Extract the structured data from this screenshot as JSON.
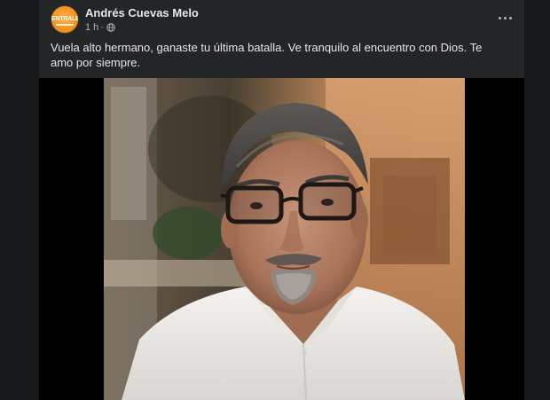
{
  "post": {
    "author": "Andrés Cuevas Melo",
    "avatar_label": "ENTRALE",
    "time": "1 h",
    "separator": "·",
    "privacy_icon": "globe-icon",
    "more_icon": "more-horizontal-icon",
    "text": "Vuela alto hermano, ganaste tu última batalla. Ve tranquilo al encuentro con Dios. Te amo por siempre."
  },
  "colors": {
    "background": "#18191a",
    "card": "#242526",
    "text_primary": "#e4e6eb",
    "text_secondary": "#b0b3b8",
    "avatar_accent": "#f7921c"
  }
}
